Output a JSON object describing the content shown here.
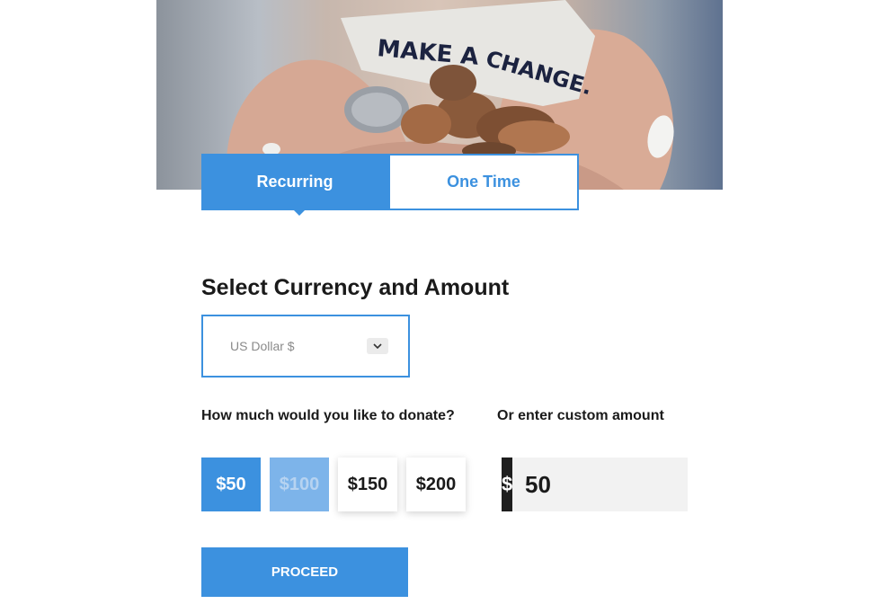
{
  "hero": {
    "image_text_line1": "MAKE A",
    "image_text_line2": "CHANGE."
  },
  "tabs": [
    {
      "label": "Recurring",
      "active": true
    },
    {
      "label": "One Time",
      "active": false
    }
  ],
  "form": {
    "heading": "Select Currency and Amount",
    "currency": {
      "selected": "US Dollar $"
    },
    "amount_label": "How much would you like to donate?",
    "amounts": [
      "$50",
      "$100",
      "$150",
      "$200"
    ],
    "selected_amount": "$50",
    "custom_label": "Or enter custom amount",
    "custom_prefix": "$",
    "custom_value": "50",
    "proceed_label": "PROCEED"
  },
  "colors": {
    "accent": "#3c91df",
    "accent_faded": "#7db4ea",
    "text": "#1a1a1a"
  }
}
